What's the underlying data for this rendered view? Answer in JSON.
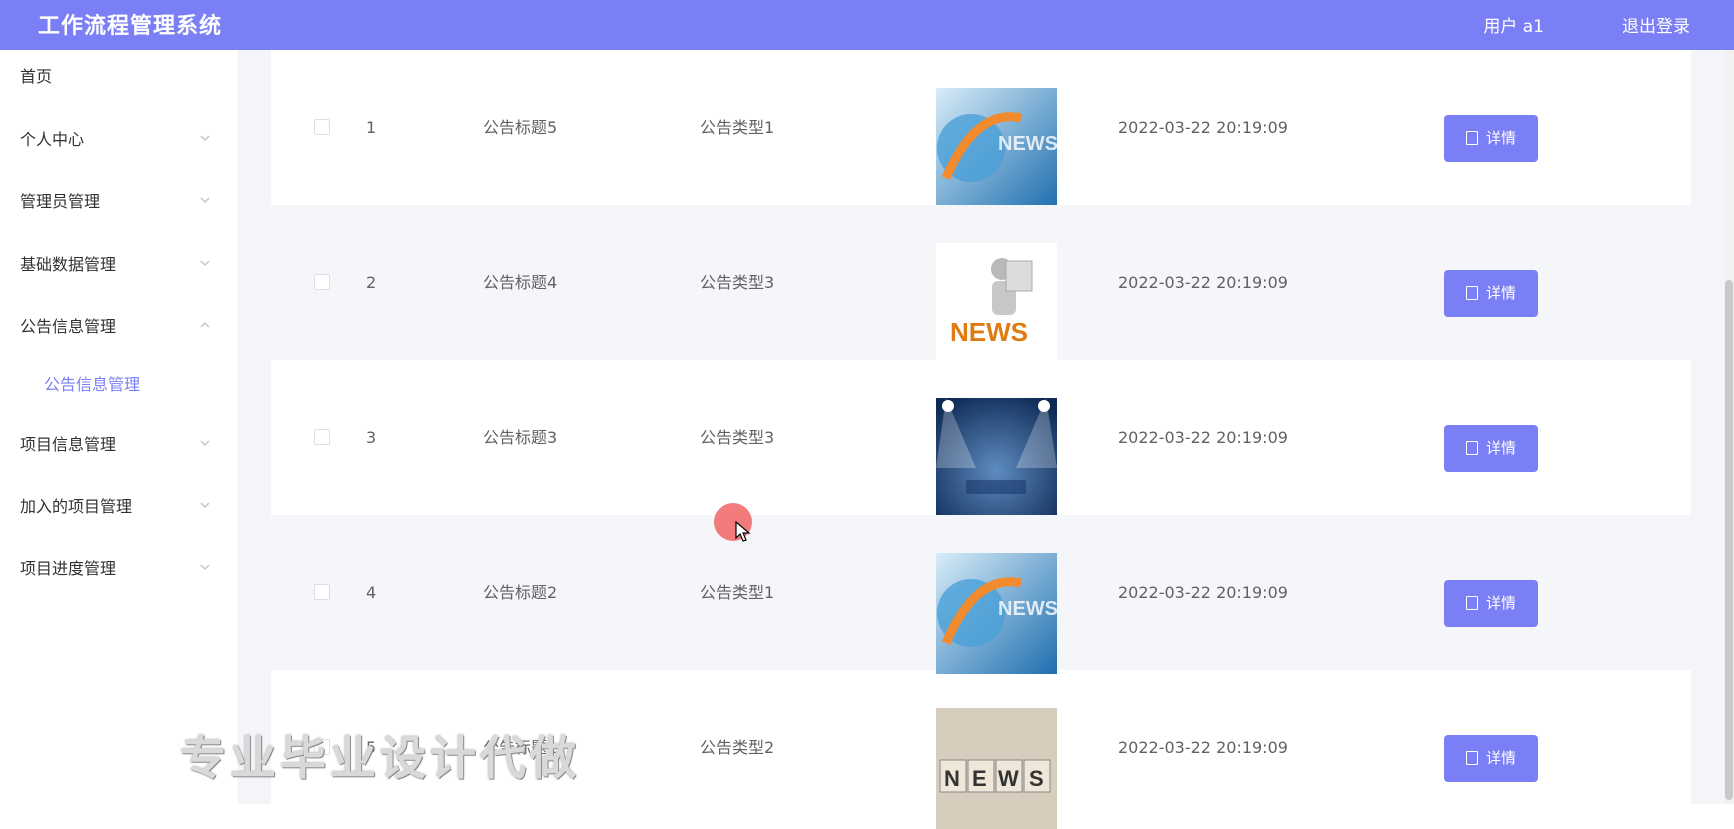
{
  "header": {
    "title": "工作流程管理系统",
    "user": "用户 a1",
    "logout": "退出登录"
  },
  "sidebar": {
    "items": [
      {
        "label": "首页",
        "has_chevron": false
      },
      {
        "label": "个人中心",
        "has_chevron": true
      },
      {
        "label": "管理员管理",
        "has_chevron": true
      },
      {
        "label": "基础数据管理",
        "has_chevron": true
      },
      {
        "label": "公告信息管理",
        "has_chevron": true
      },
      {
        "label": "公告信息管理",
        "sub": true,
        "active": true
      },
      {
        "label": "项目信息管理",
        "has_chevron": true
      },
      {
        "label": "加入的项目管理",
        "has_chevron": true
      },
      {
        "label": "项目进度管理",
        "has_chevron": true
      }
    ]
  },
  "table": {
    "detail_label": "详情",
    "rows": [
      {
        "index": "1",
        "title": "公告标题5",
        "type": "公告类型1",
        "image": "news-globe-image",
        "time": "2022-03-22 20:19:09"
      },
      {
        "index": "2",
        "title": "公告标题4",
        "type": "公告类型3",
        "image": "news-3d-figure-image",
        "time": "2022-03-22 20:19:09"
      },
      {
        "index": "3",
        "title": "公告标题3",
        "type": "公告类型3",
        "image": "news-stage-image",
        "time": "2022-03-22 20:19:09"
      },
      {
        "index": "4",
        "title": "公告标题2",
        "type": "公告类型1",
        "image": "news-globe-image",
        "time": "2022-03-22 20:19:09"
      },
      {
        "index": "5",
        "title": "公告标题1",
        "type": "公告类型2",
        "image": "news-blocks-image",
        "time": "2022-03-22 20:19:09"
      }
    ]
  },
  "watermark": "专业毕业设计代做",
  "colors": {
    "accent": "#7b7ff5",
    "row_alt": "#f5f6fa"
  }
}
